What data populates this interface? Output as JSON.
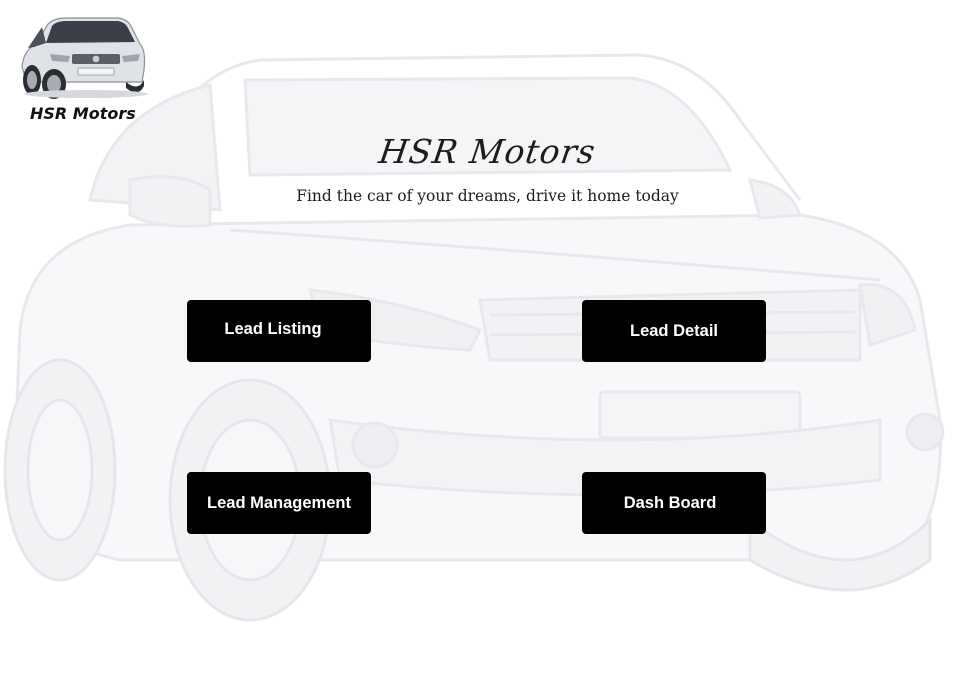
{
  "brand": {
    "name": "HSR Motors",
    "logo_icon": "car-icon"
  },
  "hero": {
    "title": "HSR Motors",
    "subtitle": "Find the car of your dreams, drive it home today"
  },
  "nav": {
    "lead_listing": "Lead Listing",
    "lead_detail": "Lead Detail",
    "lead_management": "Lead Management",
    "dashboard": "Dash Board"
  },
  "colors": {
    "button_bg": "#000000",
    "button_text": "#ffffff",
    "background": "#ffffff"
  }
}
